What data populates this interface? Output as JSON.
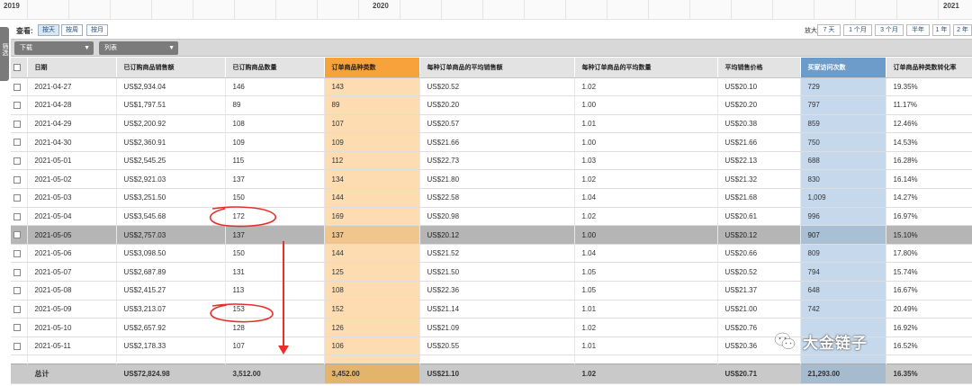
{
  "timeline": {
    "years": [
      "2019",
      "2020",
      "2021"
    ]
  },
  "side_tab": {
    "label": "筛选"
  },
  "view": {
    "label": "查看:",
    "options": [
      "按天",
      "按周",
      "按月"
    ],
    "active": 0
  },
  "zoom": {
    "label": "放大:",
    "options": [
      "7 天",
      "1 个月",
      "3 个月",
      "半年",
      "1 年",
      "2 年"
    ]
  },
  "filters": {
    "download": "下载",
    "columns": "列表"
  },
  "table": {
    "columns": [
      "日期",
      "已订购商品销售额",
      "已订购商品数量",
      "订单商品种类数",
      "每种订单商品的平均销售额",
      "每种订单商品的平均数量",
      "平均销售价格",
      "买家访问次数",
      "订单商品种类数转化率"
    ],
    "rows": [
      [
        "2021-04-27",
        "US$2,934.04",
        "146",
        "143",
        "US$20.52",
        "1.02",
        "US$20.10",
        "729",
        "19.35%"
      ],
      [
        "2021-04-28",
        "US$1,797.51",
        "89",
        "89",
        "US$20.20",
        "1.00",
        "US$20.20",
        "797",
        "11.17%"
      ],
      [
        "2021-04-29",
        "US$2,200.92",
        "108",
        "107",
        "US$20.57",
        "1.01",
        "US$20.38",
        "859",
        "12.46%"
      ],
      [
        "2021-04-30",
        "US$2,360.91",
        "109",
        "109",
        "US$21.66",
        "1.00",
        "US$21.66",
        "750",
        "14.53%"
      ],
      [
        "2021-05-01",
        "US$2,545.25",
        "115",
        "112",
        "US$22.73",
        "1.03",
        "US$22.13",
        "688",
        "16.28%"
      ],
      [
        "2021-05-02",
        "US$2,921.03",
        "137",
        "134",
        "US$21.80",
        "1.02",
        "US$21.32",
        "830",
        "16.14%"
      ],
      [
        "2021-05-03",
        "US$3,251.50",
        "150",
        "144",
        "US$22.58",
        "1.04",
        "US$21.68",
        "1,009",
        "14.27%"
      ],
      [
        "2021-05-04",
        "US$3,545.68",
        "172",
        "169",
        "US$20.98",
        "1.02",
        "US$20.61",
        "996",
        "16.97%"
      ],
      [
        "2021-05-05",
        "US$2,757.03",
        "137",
        "137",
        "US$20.12",
        "1.00",
        "US$20.12",
        "907",
        "15.10%"
      ],
      [
        "2021-05-06",
        "US$3,098.50",
        "150",
        "144",
        "US$21.52",
        "1.04",
        "US$20.66",
        "809",
        "17.80%"
      ],
      [
        "2021-05-07",
        "US$2,687.89",
        "131",
        "125",
        "US$21.50",
        "1.05",
        "US$20.52",
        "794",
        "15.74%"
      ],
      [
        "2021-05-08",
        "US$2,415.27",
        "113",
        "108",
        "US$22.36",
        "1.05",
        "US$21.37",
        "648",
        "16.67%"
      ],
      [
        "2021-05-09",
        "US$3,213.07",
        "153",
        "152",
        "US$21.14",
        "1.01",
        "US$21.00",
        "742",
        "20.49%"
      ],
      [
        "2021-05-10",
        "US$2,657.92",
        "128",
        "126",
        "US$21.09",
        "1.02",
        "US$20.76",
        "",
        "16.92%"
      ],
      [
        "2021-05-11",
        "US$2,178.33",
        "107",
        "106",
        "US$20.55",
        "1.01",
        "US$20.36",
        "",
        "16.52%"
      ]
    ],
    "highlighted_row": 8,
    "total": [
      "总计",
      "US$72,824.98",
      "3,512.00",
      "3,452.00",
      "US$21.10",
      "1.02",
      "US$20.71",
      "21,293.00",
      "16.35%"
    ]
  },
  "watermark": {
    "text": "大金链子"
  },
  "colors": {
    "orange_header": "#f7a23a",
    "orange_column": "#fcdcb0",
    "blue_header": "#6d9ccb",
    "blue_column": "#c6d9ec",
    "annotation_red": "#e8302a"
  }
}
